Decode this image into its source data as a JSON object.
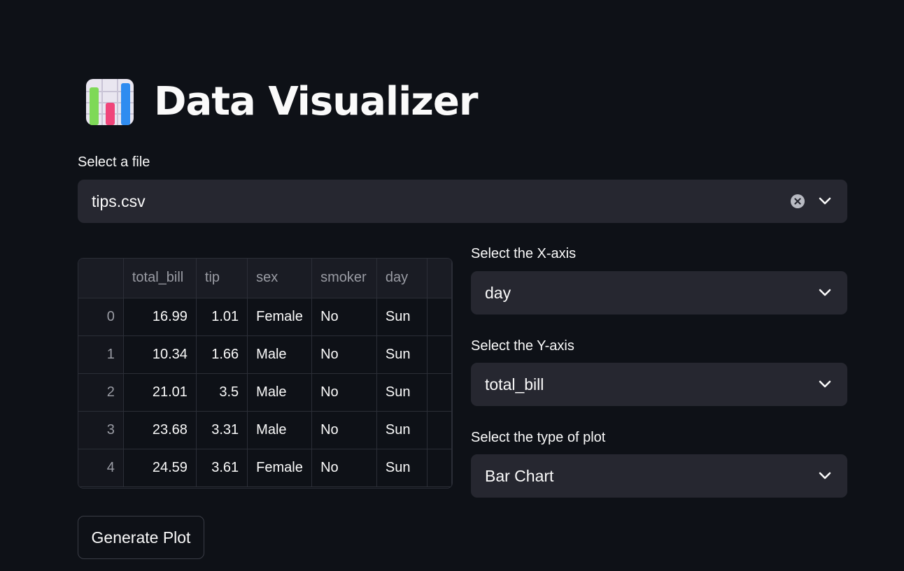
{
  "header": {
    "title": "Data Visualizer",
    "icon": "bar-chart-icon"
  },
  "file_select": {
    "label": "Select a file",
    "value": "tips.csv"
  },
  "table": {
    "columns": [
      "",
      "total_bill",
      "tip",
      "sex",
      "smoker",
      "day"
    ],
    "rows": [
      [
        "0",
        "16.99",
        "1.01",
        "Female",
        "No",
        "Sun"
      ],
      [
        "1",
        "10.34",
        "1.66",
        "Male",
        "No",
        "Sun"
      ],
      [
        "2",
        "21.01",
        "3.5",
        "Male",
        "No",
        "Sun"
      ],
      [
        "3",
        "23.68",
        "3.31",
        "Male",
        "No",
        "Sun"
      ],
      [
        "4",
        "24.59",
        "3.61",
        "Female",
        "No",
        "Sun"
      ]
    ]
  },
  "x_axis_select": {
    "label": "Select the X-axis",
    "value": "day"
  },
  "y_axis_select": {
    "label": "Select the Y-axis",
    "value": "total_bill"
  },
  "plot_type_select": {
    "label": "Select the type of plot",
    "value": "Bar Chart"
  },
  "generate_button": {
    "label": "Generate Plot"
  },
  "colors": {
    "background": "#0e1117",
    "input_background": "#262730",
    "text": "#fafafa",
    "muted_text": "#9a9ca4"
  }
}
